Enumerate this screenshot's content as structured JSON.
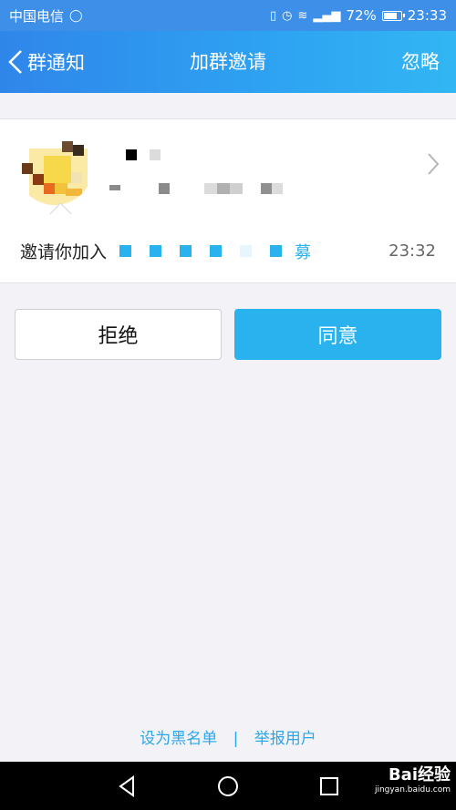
{
  "status_bar": {
    "carrier": "中国电信",
    "battery": "72%",
    "time": "23:33"
  },
  "nav": {
    "back_label": "群通知",
    "title": "加群邀请",
    "action_label": "忽略"
  },
  "invite": {
    "text": "邀请你加入",
    "group_name_visible_tail": "募",
    "time": "23:32"
  },
  "buttons": {
    "reject": "拒绝",
    "accept": "同意"
  },
  "footer": {
    "blacklist": "设为黑名单",
    "separator": "|",
    "report": "举报用户"
  },
  "watermark": {
    "brand": "Bai经验",
    "url": "jingyan.baidu.com"
  },
  "colors": {
    "accent": "#2ab2ee",
    "nav_start": "#2f86ea",
    "nav_end": "#32b6f3"
  }
}
